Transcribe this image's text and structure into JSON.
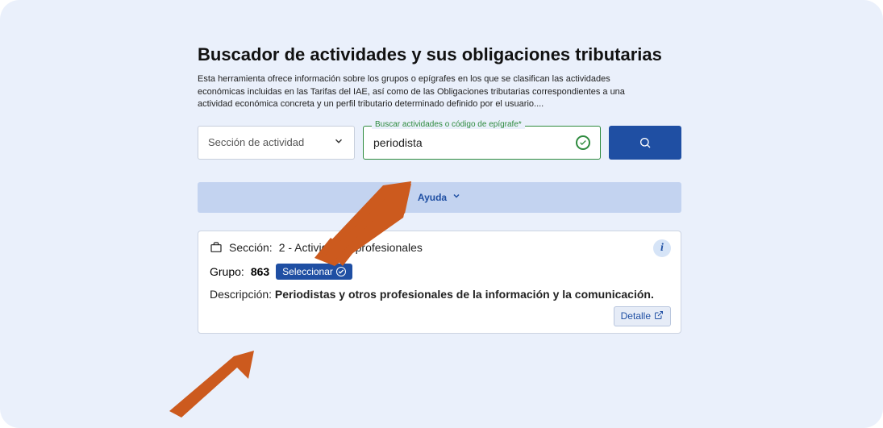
{
  "header": {
    "title": "Buscador de actividades y sus obligaciones tributarias",
    "intro": "Esta herramienta ofrece información sobre los grupos o epígrafes en los que se clasifican las actividades económicas incluidas en las Tarifas del IAE, así como de las Obligaciones tributarias correspondientes a una actividad económica concreta y un perfil tributario determinado definido por el usuario...."
  },
  "search": {
    "section_placeholder": "Sección de actividad",
    "input_label": "Buscar actividades o código de epígrafe*",
    "value": "periodista"
  },
  "help": {
    "label": "Ayuda"
  },
  "result": {
    "section_label": "Sección:",
    "section_value": "2 - Actividades profesionales",
    "grupo_label": "Grupo:",
    "grupo_code": "863",
    "select_label": "Seleccionar",
    "desc_label": "Descripción:",
    "desc_value": "Periodistas y otros profesionales de la información y la comunicación.",
    "detail_label": "Detalle"
  }
}
